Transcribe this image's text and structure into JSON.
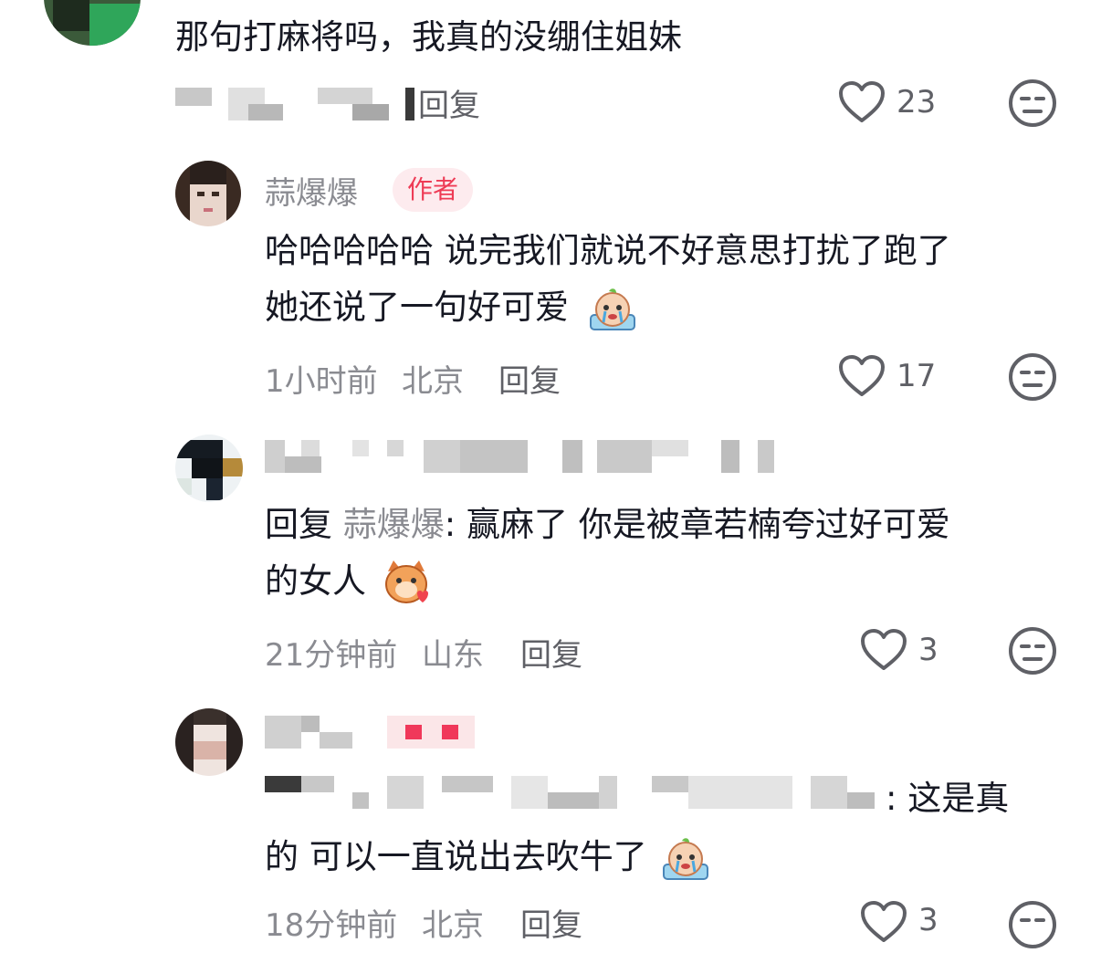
{
  "comments": [
    {
      "text_line1": "那句打麻将吗，我真的没绷住姐妹",
      "reply_label": "回复",
      "like_count": "23"
    },
    {
      "author_name": "蒜爆爆",
      "author_badge": "作者",
      "text_line1": "哈哈哈哈哈 说完我们就说不好意思打扰了跑了",
      "text_line2": "她还说了一句好可爱",
      "time": "1小时前",
      "location": "北京",
      "reply_label": "回复",
      "like_count": "17"
    },
    {
      "reply_prefix": "回复",
      "reply_to": "蒜爆爆",
      "text_line1": ": 赢麻了 你是被章若楠夸过好可爱",
      "text_line2": "的女人",
      "time": "21分钟前",
      "location": "山东",
      "reply_label": "回复",
      "like_count": "3"
    },
    {
      "text_line1_tail": ": 这是真",
      "text_line2": "的 可以一直说出去吹牛了",
      "time": "18分钟前",
      "location": "北京",
      "reply_label": "回复",
      "like_count": "3"
    }
  ],
  "icons": {
    "like": "heart-outline-icon",
    "dislike": "meh-face-icon"
  },
  "colors": {
    "badge_text": "#ee3b55",
    "badge_bg": "#fdebee",
    "meta": "#8a8b91"
  }
}
